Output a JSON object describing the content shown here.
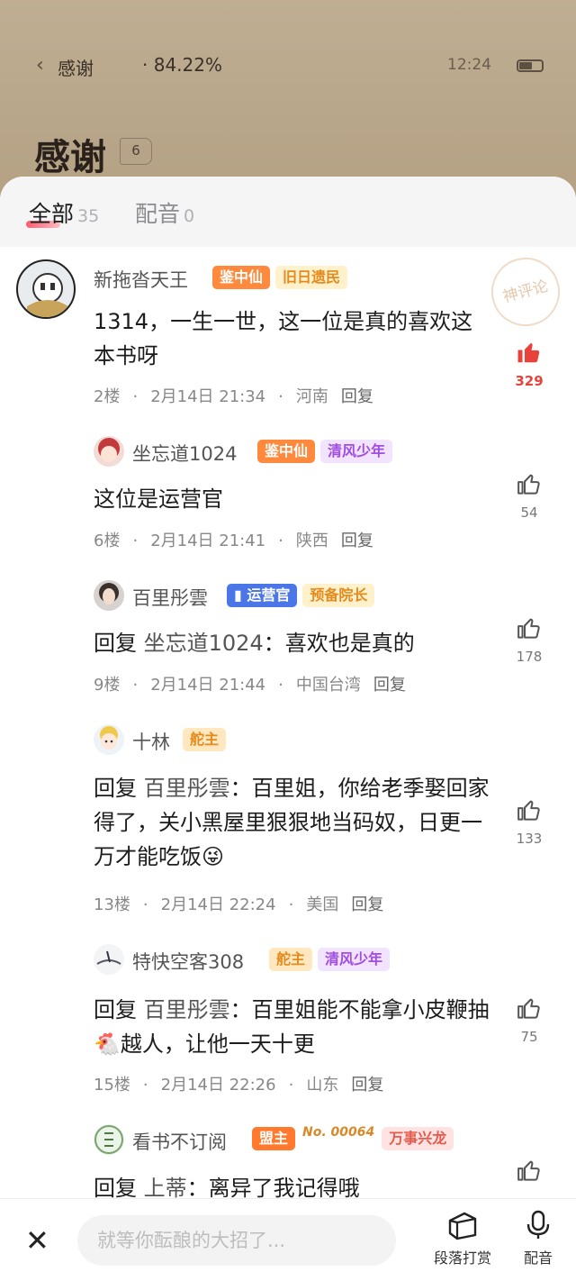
{
  "status": {
    "back_title": "感谢",
    "progress": "· 84.22%",
    "time": "12:24"
  },
  "chapter": {
    "title": "感谢",
    "count": "6"
  },
  "tabs": [
    {
      "label": "全部",
      "count": "35"
    },
    {
      "label": "配音",
      "count": "0"
    }
  ],
  "stamp": "神评论",
  "comments": [
    {
      "user": "新拖沓天王",
      "badges": [
        "鉴中仙",
        "旧日遗民"
      ],
      "text": "1314，一生一世，这一位是真的喜欢这本书呀",
      "floor": "2楼",
      "date": "2月14日 21:34",
      "region": "河南",
      "reply": "回复",
      "likes": "329"
    },
    {
      "user": "坐忘道1024",
      "badges": [
        "鉴中仙",
        "清风少年"
      ],
      "text": "这位是运营官",
      "floor": "6楼",
      "date": "2月14日 21:41",
      "region": "陕西",
      "reply": "回复",
      "likes": "54"
    },
    {
      "user": "百里彤雲",
      "badges": [
        "运营官",
        "预备院长"
      ],
      "reply_prefix": "回复",
      "reply_to": "坐忘道1024",
      "text": "：喜欢也是真的",
      "floor": "9楼",
      "date": "2月14日 21:44",
      "region": "中国台湾",
      "reply": "回复",
      "likes": "178"
    },
    {
      "user": "十林",
      "badges": [
        "舵主"
      ],
      "reply_prefix": "回复",
      "reply_to": "百里彤雲",
      "text": "：百里姐，你给老季娶回家得了，关小黑屋里狠狠地当码奴，日更一万才能吃饭😜",
      "floor": "13楼",
      "date": "2月14日 22:24",
      "region": "美国",
      "reply": "回复",
      "likes": "133"
    },
    {
      "user": "特快空客308",
      "badges": [
        "舵主",
        "清风少年"
      ],
      "reply_prefix": "回复",
      "reply_to": "百里彤雲",
      "text": "：百里姐能不能拿小皮鞭抽🐔越人，让他一天十更",
      "floor": "15楼",
      "date": "2月14日 22:26",
      "region": "山东",
      "reply": "回复",
      "likes": "75"
    },
    {
      "user": "看书不订阅",
      "badges": [
        "盟主",
        "No. 00064",
        "万事兴龙"
      ],
      "reply_prefix": "回复",
      "reply_to": "上蒂",
      "text": "：离异了我记得哦"
    }
  ],
  "bottom": {
    "input_placeholder": "就等你酝酿的大招了...",
    "reward_label": "段落打赏",
    "dub_label": "配音"
  },
  "colors": {
    "accent": "#e8433a",
    "badge_orange": "#ff8a3d",
    "badge_blue": "#4b76e8",
    "backdrop": "#b9a68c"
  }
}
